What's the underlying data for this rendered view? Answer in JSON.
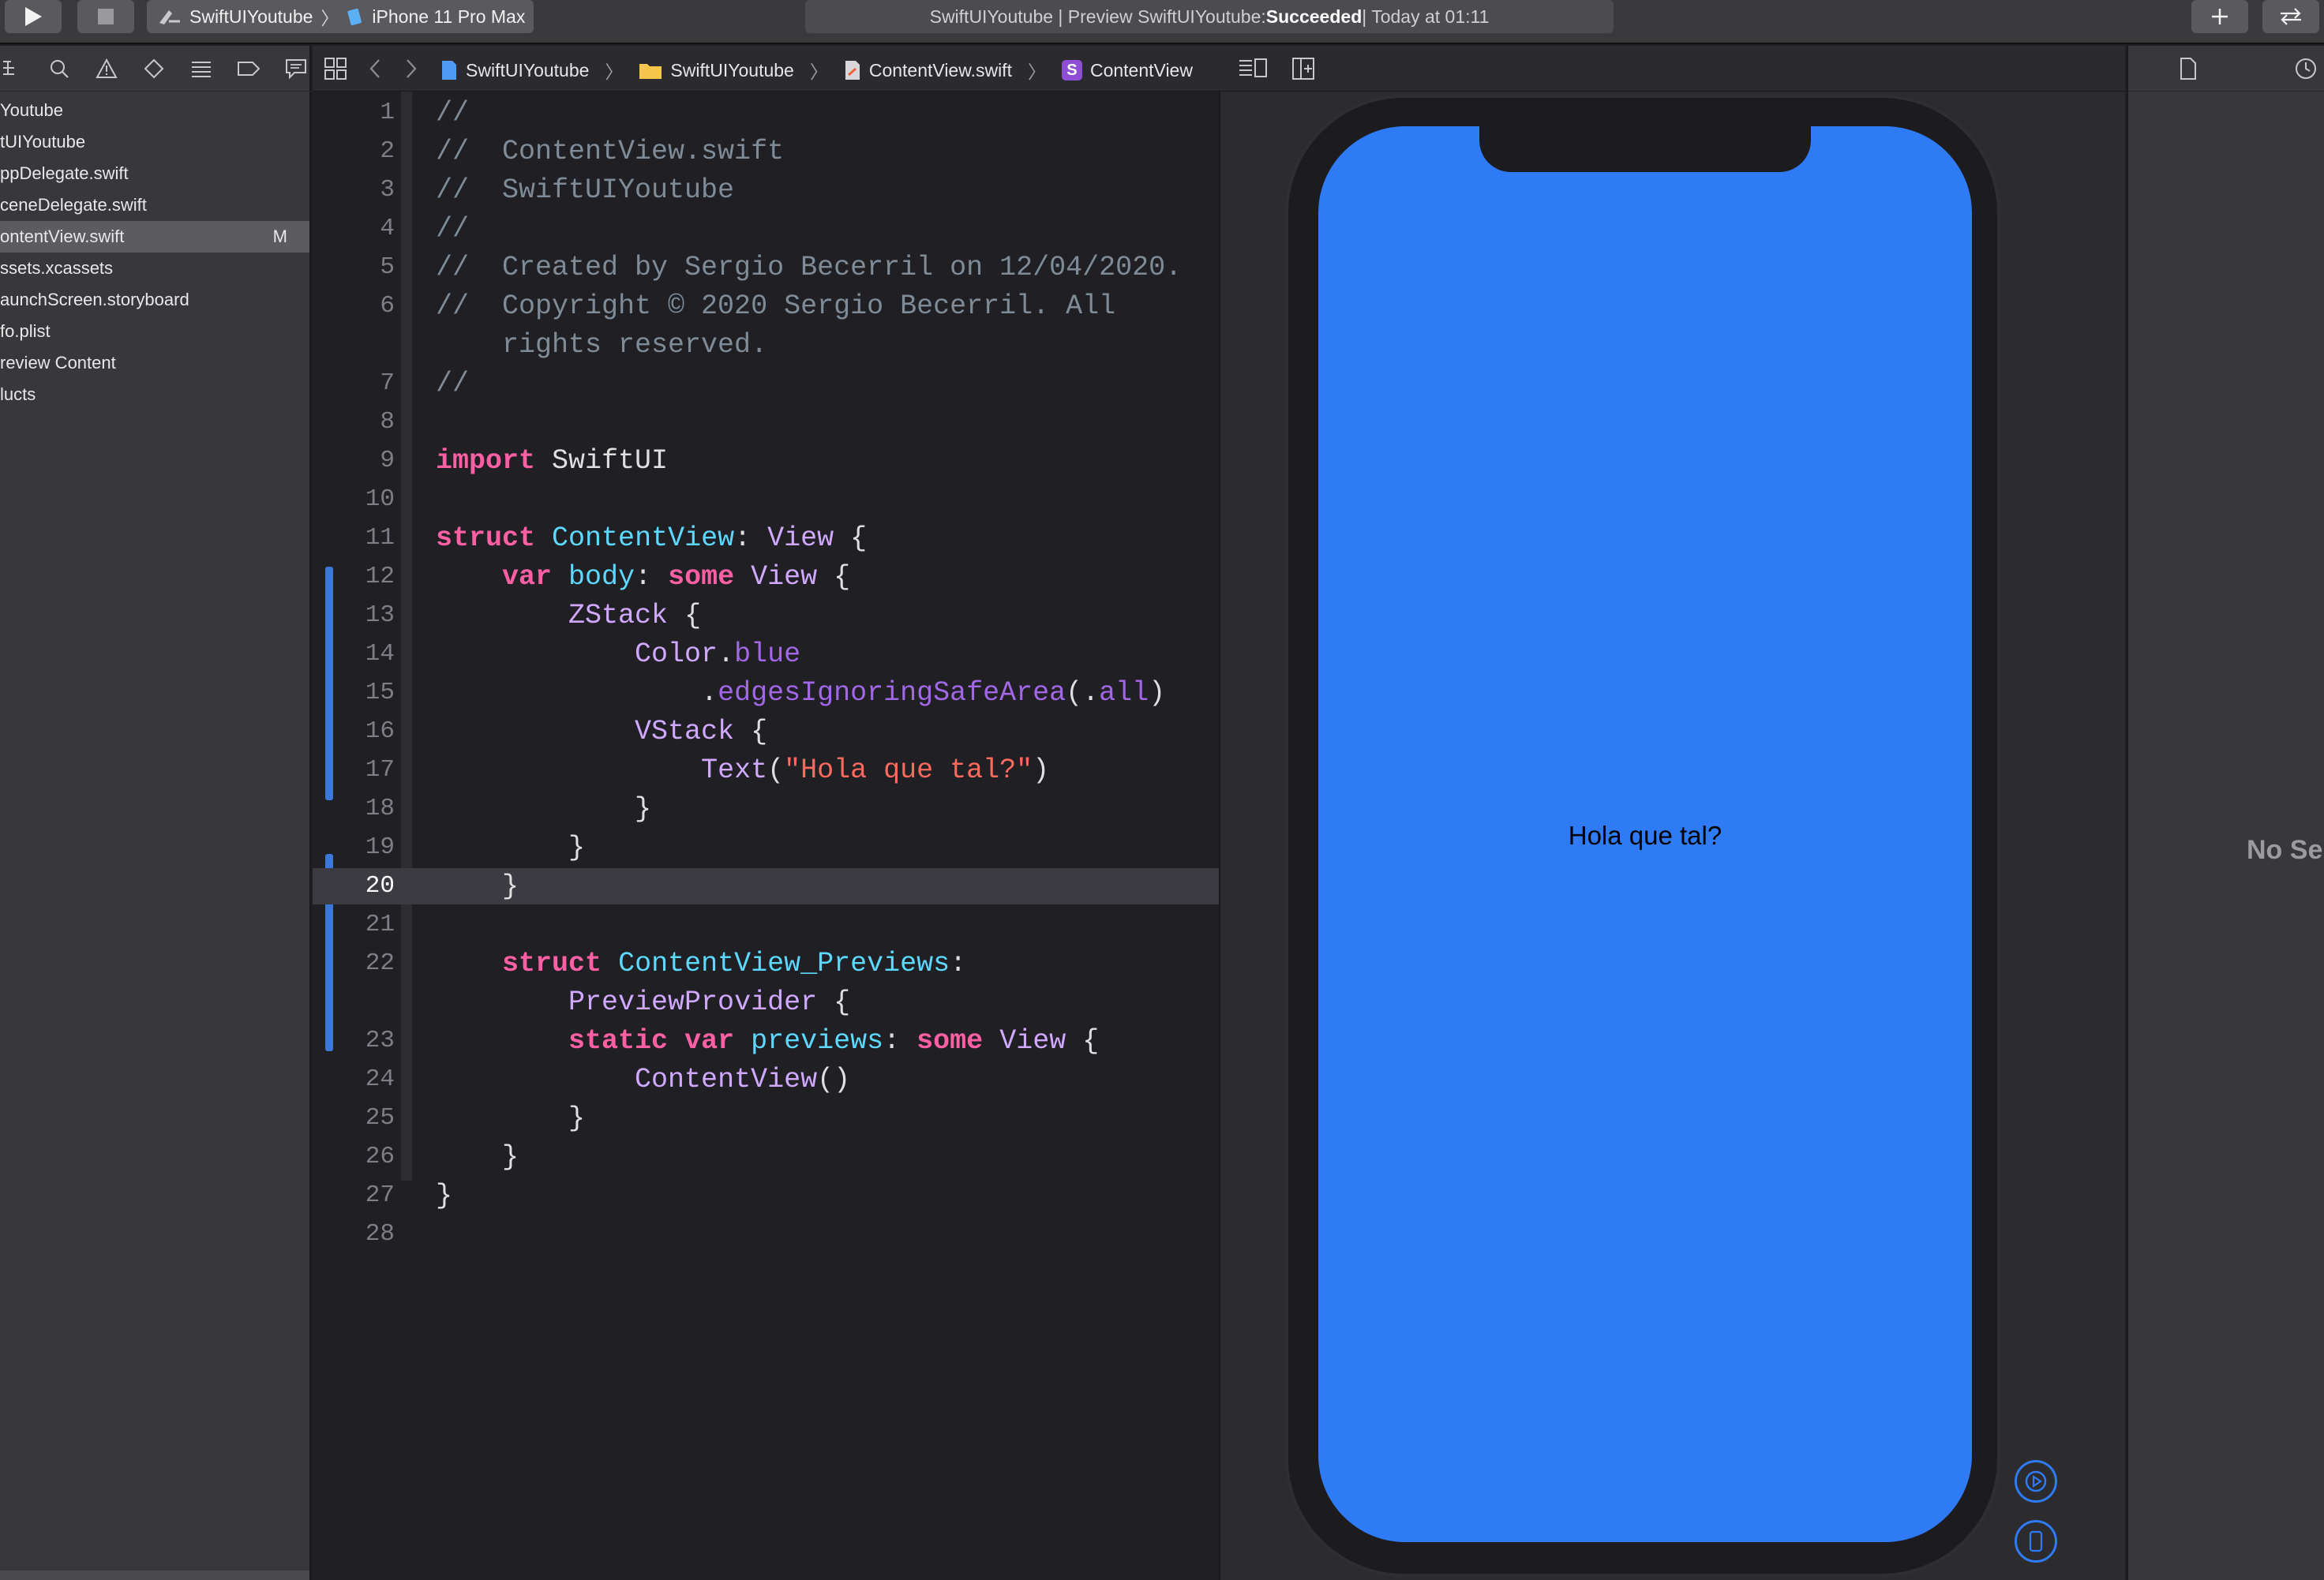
{
  "toolbar": {
    "scheme_project": "SwiftUIYoutube",
    "scheme_device": "iPhone 11 Pro Max",
    "status_prefix": "SwiftUIYoutube | Preview SwiftUIYoutube: ",
    "status_result": "Succeeded",
    "status_suffix": " | Today at 01:11"
  },
  "navigator": {
    "items": [
      {
        "label": "Youtube"
      },
      {
        "label": "tUIYoutube"
      },
      {
        "label": "ppDelegate.swift"
      },
      {
        "label": "ceneDelegate.swift"
      },
      {
        "label": "ontentView.swift",
        "badge": "M"
      },
      {
        "label": "ssets.xcassets"
      },
      {
        "label": "aunchScreen.storyboard"
      },
      {
        "label": "fo.plist"
      },
      {
        "label": "review Content"
      },
      {
        "label": "lucts"
      }
    ]
  },
  "jumpbar": {
    "project": "SwiftUIYoutube",
    "folder": "SwiftUIYoutube",
    "file": "ContentView.swift",
    "symbol": "ContentView",
    "symbol_badge": "S"
  },
  "editor": {
    "current_line": 20,
    "line_numbers": [
      "1",
      "2",
      "3",
      "4",
      "5",
      "6",
      "",
      "7",
      "8",
      "9",
      "10",
      "11",
      "12",
      "13",
      "14",
      "15",
      "16",
      "17",
      "18",
      "19",
      "20",
      "21",
      "22",
      "",
      "23",
      "24",
      "25",
      "26",
      "27",
      "28"
    ]
  },
  "preview": {
    "text": "Hola que tal?"
  },
  "inspector": {
    "placeholder": "No Se"
  },
  "colors": {
    "accent": "#3c78d8",
    "preview_background": "#2f7af5",
    "keyword": "#fc5fa3",
    "string": "#fc6a5d",
    "comment": "#7f8c98"
  }
}
